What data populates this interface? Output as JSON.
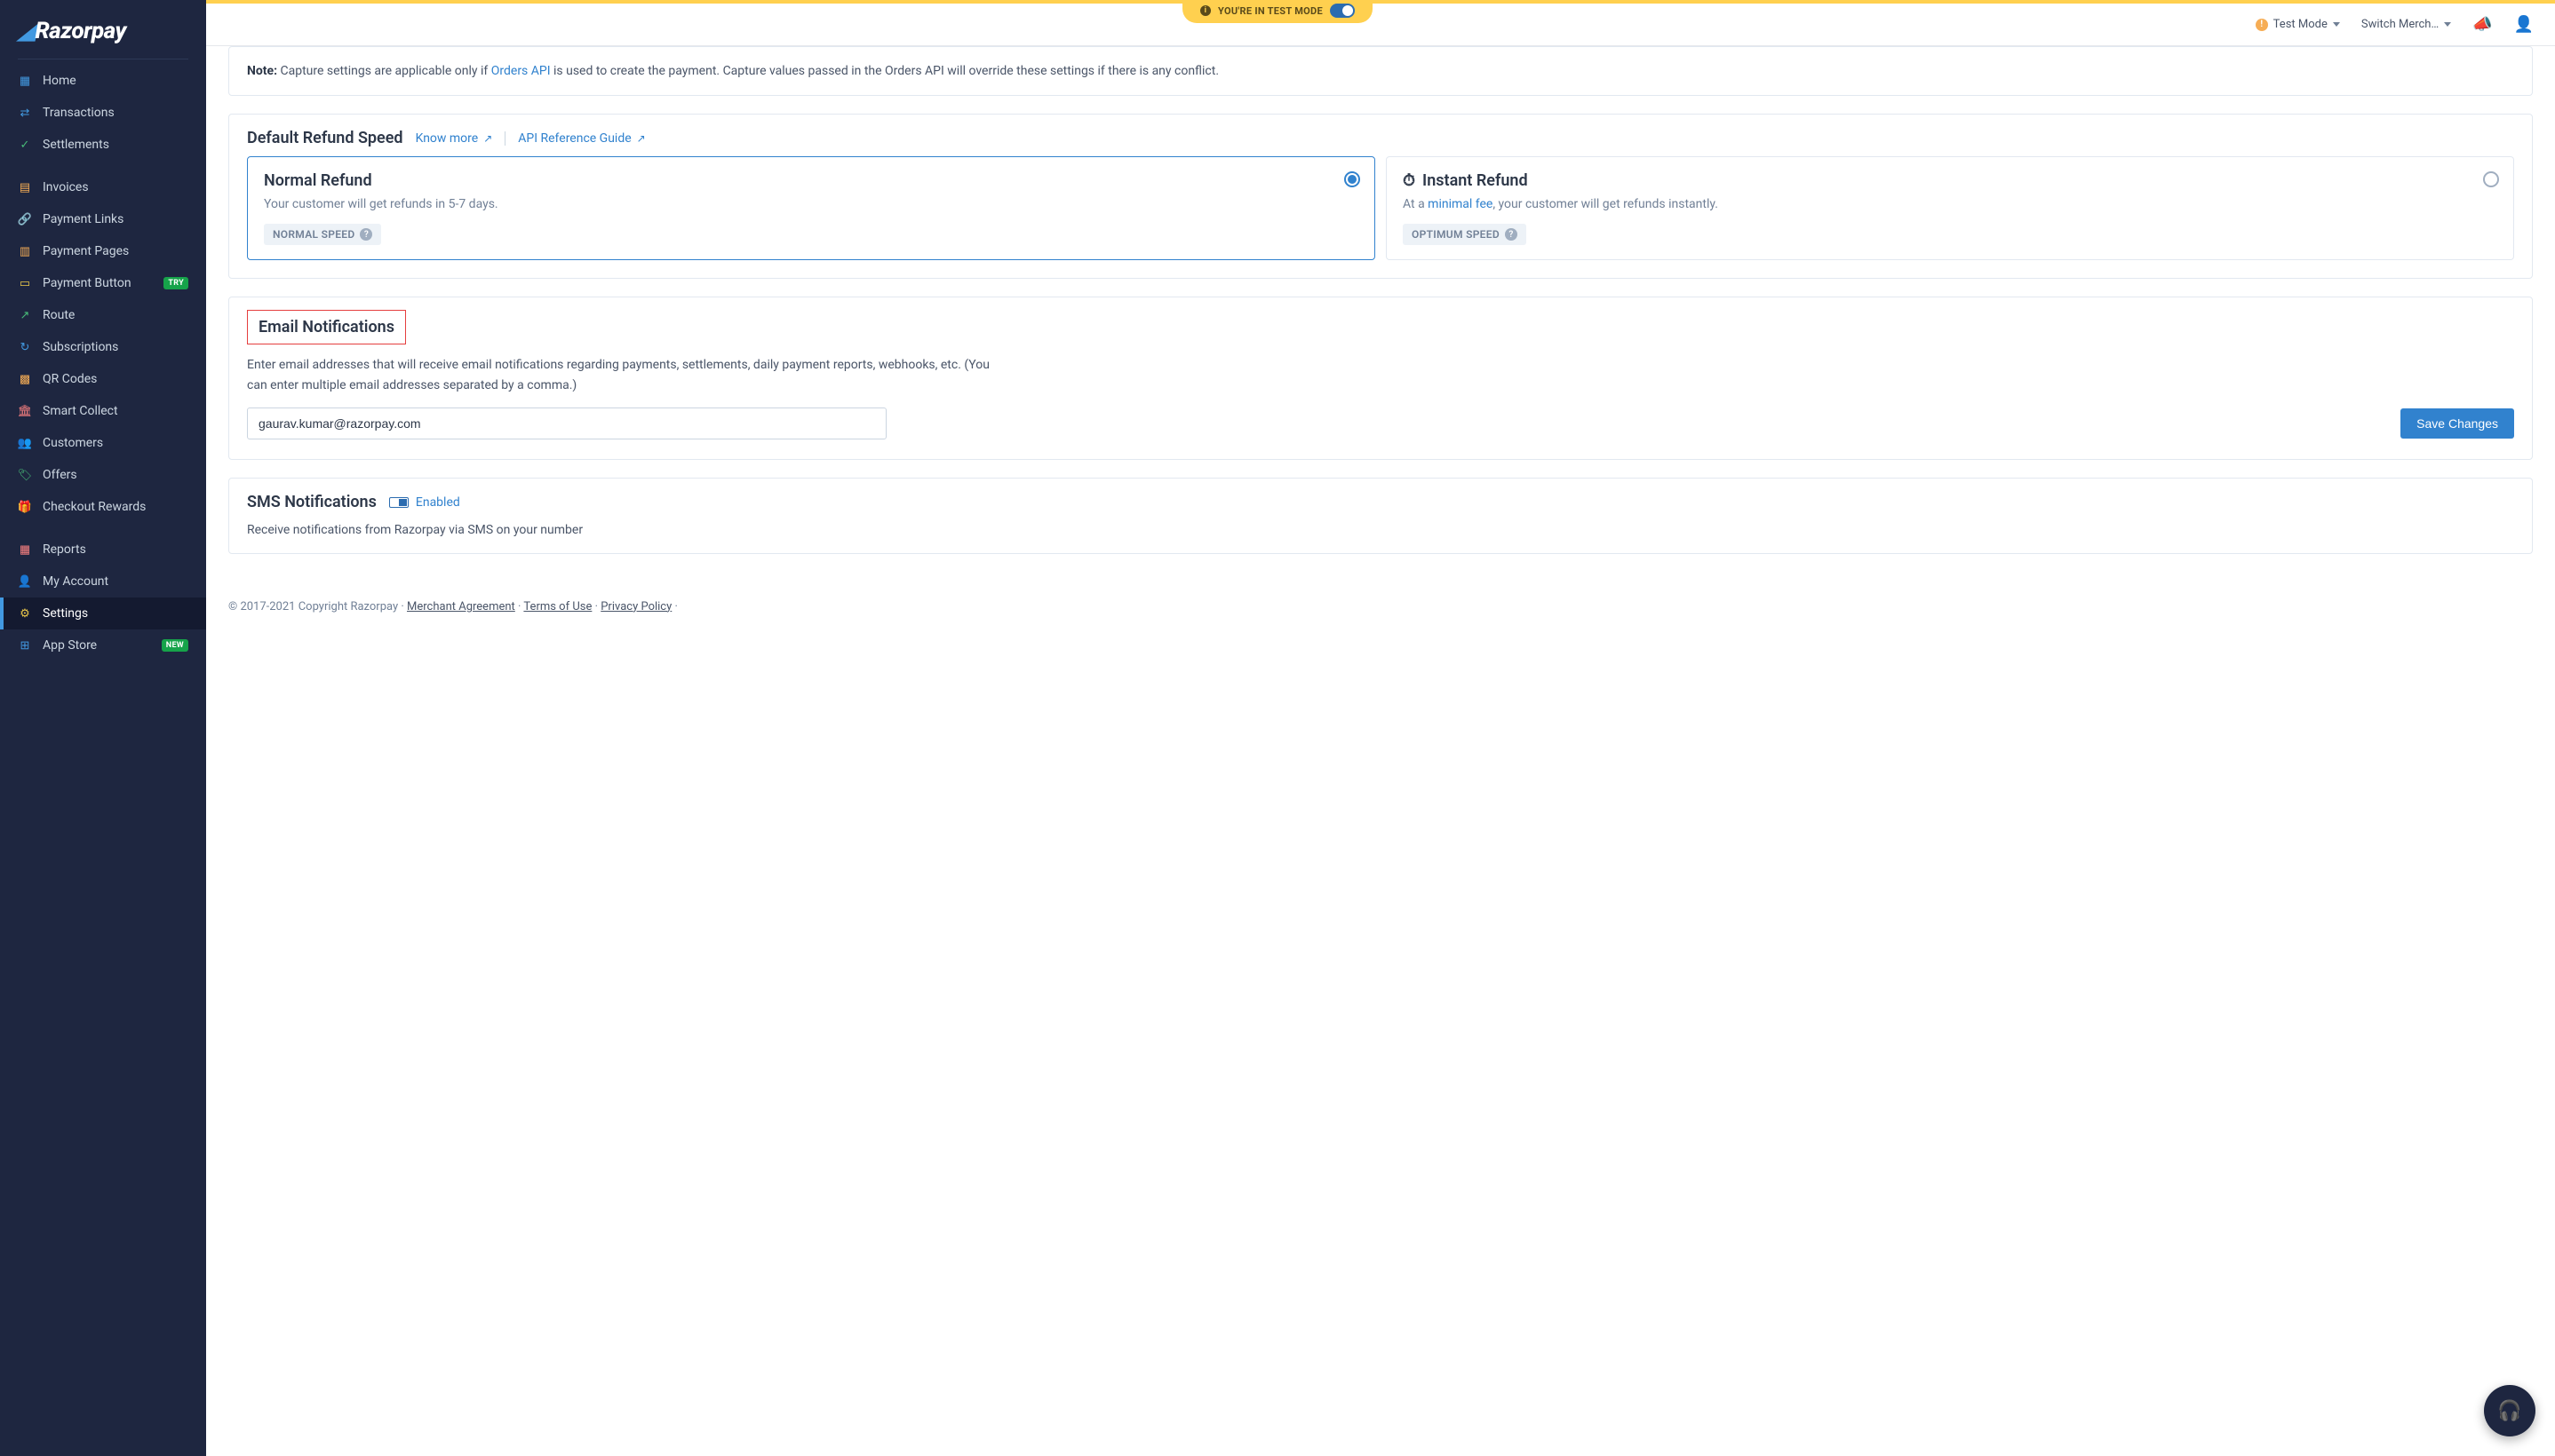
{
  "banner": {
    "text": "YOU'RE IN TEST MODE"
  },
  "header": {
    "test_mode": "Test Mode",
    "switch_merchant": "Switch Merch…"
  },
  "brand": {
    "name": "Razorpay"
  },
  "sidebar": {
    "items": [
      {
        "label": "Home",
        "key": "home"
      },
      {
        "label": "Transactions",
        "key": "transactions"
      },
      {
        "label": "Settlements",
        "key": "settlements"
      },
      {
        "label": "Invoices",
        "key": "invoices"
      },
      {
        "label": "Payment Links",
        "key": "payment-links"
      },
      {
        "label": "Payment Pages",
        "key": "payment-pages"
      },
      {
        "label": "Payment Button",
        "key": "payment-button",
        "badge": "TRY"
      },
      {
        "label": "Route",
        "key": "route"
      },
      {
        "label": "Subscriptions",
        "key": "subscriptions"
      },
      {
        "label": "QR Codes",
        "key": "qr-codes"
      },
      {
        "label": "Smart Collect",
        "key": "smart-collect"
      },
      {
        "label": "Customers",
        "key": "customers"
      },
      {
        "label": "Offers",
        "key": "offers"
      },
      {
        "label": "Checkout Rewards",
        "key": "checkout-rewards"
      },
      {
        "label": "Reports",
        "key": "reports"
      },
      {
        "label": "My Account",
        "key": "my-account"
      },
      {
        "label": "Settings",
        "key": "settings",
        "active": true
      },
      {
        "label": "App Store",
        "key": "app-store",
        "badge": "NEW"
      }
    ]
  },
  "note": {
    "prefix": "Note:",
    "text1": " Capture settings are applicable only if ",
    "link": "Orders API",
    "text2": "  is used to create the payment. Capture values passed in the Orders API will override these settings if there is any conflict."
  },
  "refund": {
    "title": "Default Refund Speed",
    "know_more": "Know more",
    "api_guide": "API Reference Guide",
    "normal": {
      "title": "Normal Refund",
      "desc": "Your customer will get refunds in 5-7 days.",
      "tag": "NORMAL SPEED"
    },
    "instant": {
      "title": "Instant Refund",
      "desc1": "At a ",
      "fee_link": "minimal fee",
      "desc2": ", your customer will get refunds instantly.",
      "tag": "OPTIMUM SPEED"
    }
  },
  "email": {
    "title": "Email Notifications",
    "desc": "Enter email addresses that will receive email notifications regarding payments, settlements, daily payment reports, webhooks, etc. (You can enter multiple email addresses separated by a comma.)",
    "value": "gaurav.kumar@razorpay.com",
    "save": "Save Changes"
  },
  "sms": {
    "title": "SMS Notifications",
    "enabled": "Enabled",
    "desc": "Receive notifications from Razorpay via SMS on your number"
  },
  "footer": {
    "copyright": "© 2017-2021 Copyright Razorpay · ",
    "merchant": "Merchant Agreement",
    "terms": "Terms of Use",
    "privacy": "Privacy Policy",
    "sep": " · "
  }
}
